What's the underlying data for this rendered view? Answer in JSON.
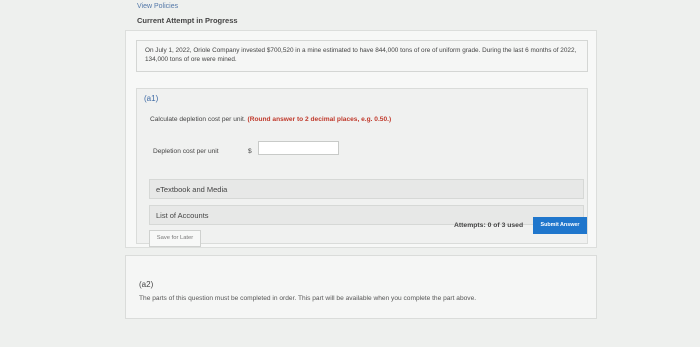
{
  "header": {
    "view_policies": "View Policies",
    "current_attempt": "Current Attempt in Progress"
  },
  "problem": {
    "text": "On July 1, 2022, Oriole Company invested $700,520 in a mine estimated to have 844,000 tons of ore of uniform grade. During the last 6 months of 2022, 134,000 tons of ore were mined."
  },
  "part_a1": {
    "label": "(a1)",
    "instruction": "Calculate depletion cost per unit.",
    "instruction_note": "(Round answer to 2 decimal places, e.g. 0.50.)",
    "field_label": "Depletion cost per unit",
    "currency": "$",
    "field_value": ""
  },
  "resources": {
    "etextbook": "eTextbook and Media",
    "list_of_accounts": "List of Accounts"
  },
  "actions": {
    "save_later": "Save for Later",
    "attempts": "Attempts: 0 of 3 used",
    "submit": "Submit Answer"
  },
  "part_a2": {
    "label": "(a2)",
    "text": "The parts of this question must be completed in order. This part will be available when you complete the part above."
  },
  "colors": {
    "accent": "#1f76cc",
    "link": "#3d6aa5",
    "note": "#c0392b"
  }
}
